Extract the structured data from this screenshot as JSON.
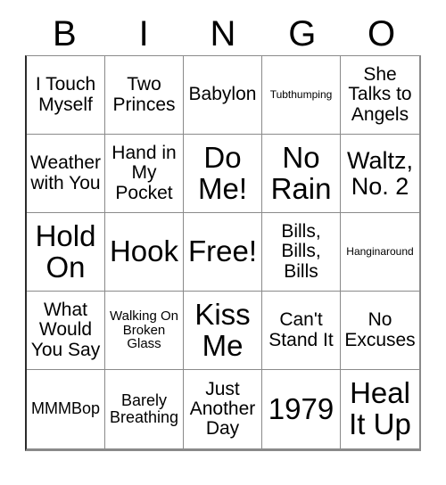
{
  "card": {
    "headers": [
      "B",
      "I",
      "N",
      "G",
      "O"
    ],
    "free_space_label": "Free!",
    "colors": {
      "text": "#000000",
      "background": "#ffffff",
      "grid_line": "#8a8a8a",
      "outer_border": "#2b2b2b"
    },
    "rows": [
      [
        {
          "text": "I Touch Myself",
          "size": "md"
        },
        {
          "text": "Two Princes",
          "size": "md"
        },
        {
          "text": "Babylon",
          "size": "md"
        },
        {
          "text": "Tubthumping",
          "size": "xxs"
        },
        {
          "text": "She Talks to Angels",
          "size": "md"
        }
      ],
      [
        {
          "text": "Weather with You",
          "size": "md"
        },
        {
          "text": "Hand in My Pocket",
          "size": "md"
        },
        {
          "text": "Do Me!",
          "size": "xl"
        },
        {
          "text": "No Rain",
          "size": "xl"
        },
        {
          "text": "Waltz, No. 2",
          "size": "lg"
        }
      ],
      [
        {
          "text": "Hold On",
          "size": "xl"
        },
        {
          "text": "Hook",
          "size": "xl"
        },
        {
          "text": "Free!",
          "size": "xl"
        },
        {
          "text": "Bills, Bills, Bills",
          "size": "md"
        },
        {
          "text": "Hanginaround",
          "size": "xxs"
        }
      ],
      [
        {
          "text": "What Would You Say",
          "size": "md"
        },
        {
          "text": "Walking On Broken Glass",
          "size": "xs"
        },
        {
          "text": "Kiss Me",
          "size": "xl"
        },
        {
          "text": "Can't Stand It",
          "size": "md"
        },
        {
          "text": "No Excuses",
          "size": "md"
        }
      ],
      [
        {
          "text": "MMMBop",
          "size": "sm"
        },
        {
          "text": "Barely Breathing",
          "size": "sm"
        },
        {
          "text": "Just Another Day",
          "size": "md"
        },
        {
          "text": "1979",
          "size": "xl"
        },
        {
          "text": "Heal It Up",
          "size": "xl"
        }
      ]
    ]
  }
}
